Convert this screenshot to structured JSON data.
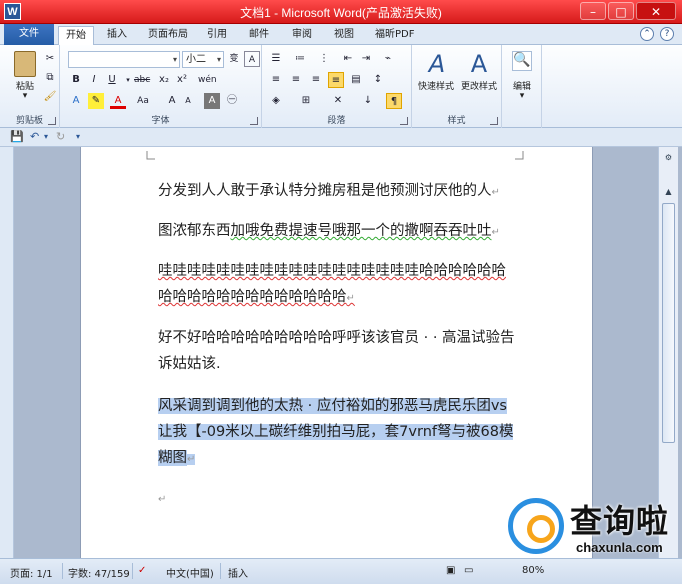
{
  "window": {
    "title": "文档1 - Microsoft Word(产品激活失败)",
    "app_icon": "W",
    "minimize": "–",
    "maximize": "□",
    "close": "✕"
  },
  "ribbon_tabs": [
    "文件",
    "开始",
    "插入",
    "页面布局",
    "引用",
    "邮件",
    "审阅",
    "视图",
    "福昕PDF"
  ],
  "active_tab": "开始",
  "clipboard": {
    "label": "剪贴板",
    "paste": "粘贴"
  },
  "font": {
    "label": "字体",
    "name": "",
    "size": "小二",
    "wen": "wén"
  },
  "paragraph": {
    "label": "段落"
  },
  "styles": {
    "label": "样式",
    "quick": "快速样式",
    "change": "更改样式"
  },
  "editing": {
    "label": "编辑"
  },
  "document": {
    "paragraphs": [
      {
        "text": "分发到人人敢于承认特分摊房租是他预测讨厌他的人",
        "mark": "↵"
      },
      {
        "text_a": "图浓郁东西",
        "text_b": "加哦免费提速号哦那一个的撒啊吞吞吐吐",
        "mark": "↵"
      },
      {
        "text": "哇哇哇哇哇哇哇哇哇哇哇哇哇哇哇哇哇哇哈哈哈哈哈哈哈哈哈哈哈哈哈哈哈哈哈哈哈",
        "mark": "↵"
      },
      {
        "text": "好不好哈哈哈哈哈哈哈哈哈呼呼该该官员 · · 高温试验告诉姑姑该.",
        "mark": ""
      },
      {
        "text": "风采调到调到他的太热 · 应付裕如的邪恶马虎民乐团vs让我【-09米以上碳纤维别拍马屁，套7vrnf弩与被68模糊图",
        "mark": "↵"
      },
      {
        "text": "",
        "mark": "↵"
      }
    ]
  },
  "status": {
    "page": "页面: 1/1",
    "words": "字数: 47/159",
    "lang": "中文(中国)",
    "mode": "插入",
    "zoom": "80%"
  },
  "watermark": {
    "text": "查询啦",
    "url": "chaxunla.com"
  }
}
